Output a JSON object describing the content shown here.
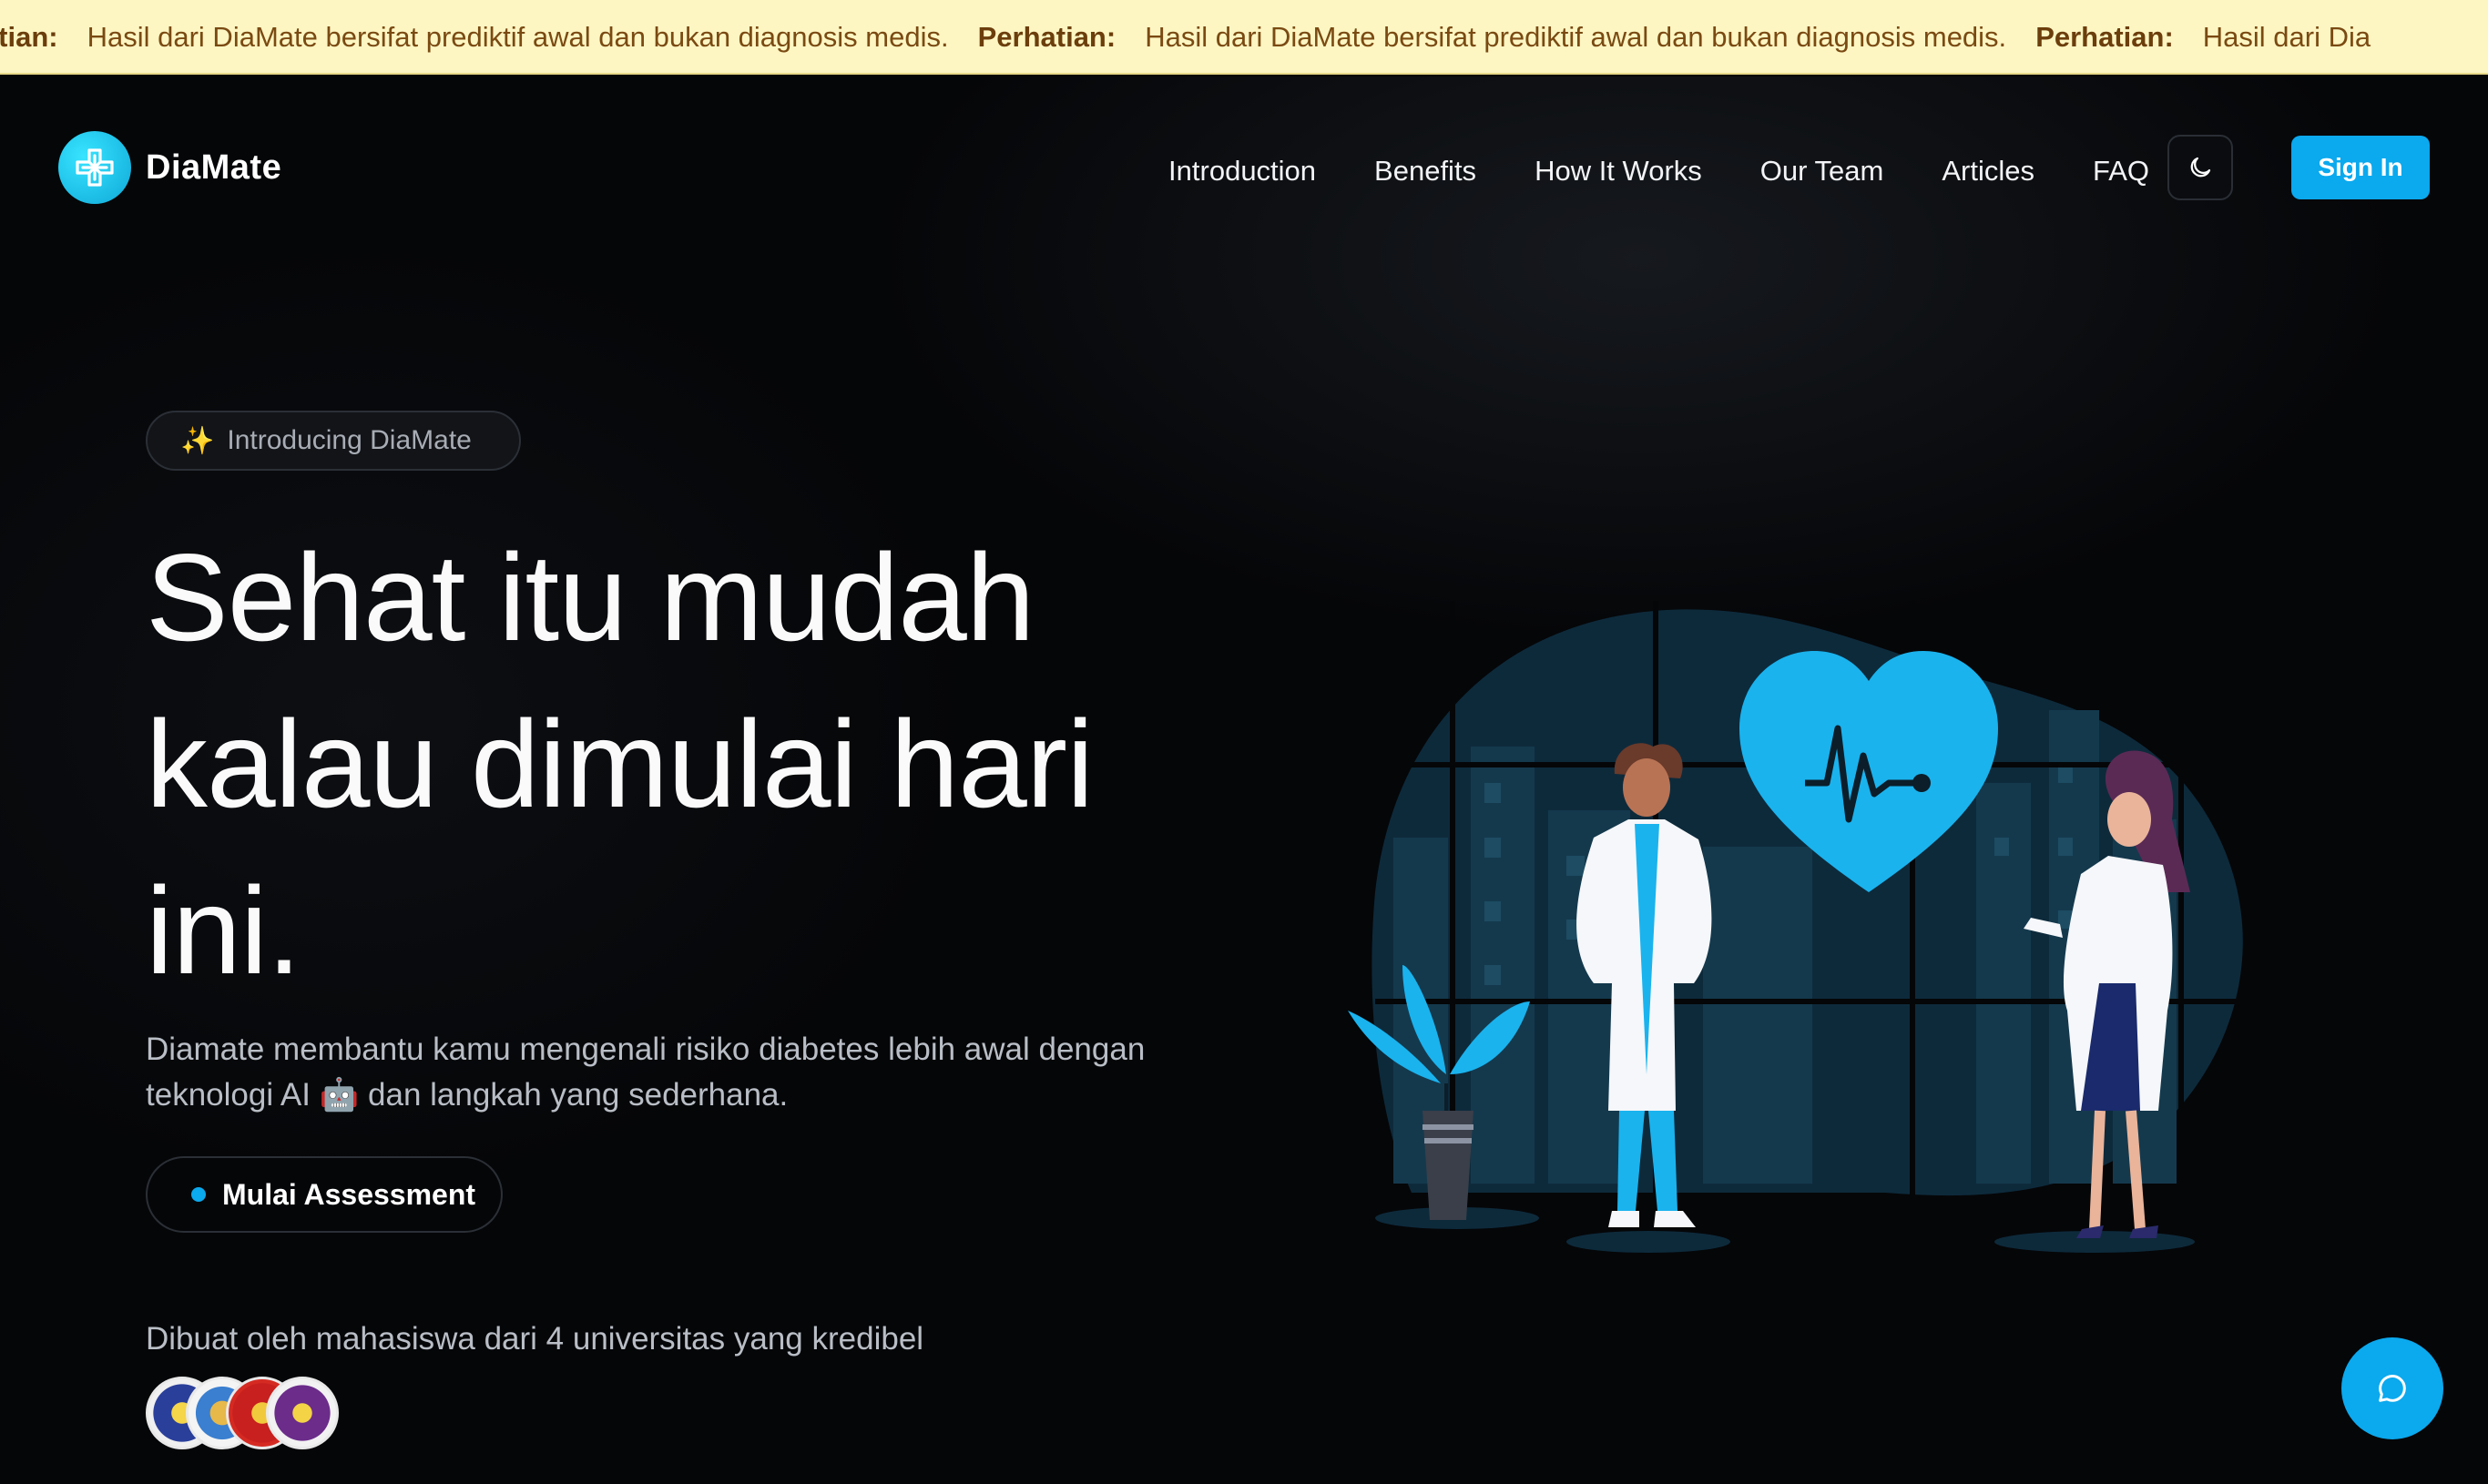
{
  "banner": {
    "label": "Perhatian:",
    "label_cut": "atian:",
    "message": "Hasil dari DiaMate bersifat prediktif awal dan bukan diagnosis medis.",
    "tail": "Hasil dari Dia"
  },
  "brand": {
    "name": "DiaMate",
    "accent": "#0ba9ee",
    "logo_icon": "cross-medical-icon"
  },
  "nav": {
    "links": [
      "Introduction",
      "Benefits",
      "How It Works",
      "Our Team",
      "Articles",
      "FAQ"
    ],
    "theme_icon": "moon-icon",
    "signin_label": "Sign In"
  },
  "hero": {
    "pill_icon": "sparkles-icon",
    "pill_label": "Introducing DiaMate",
    "headline_line1": "Sehat itu mudah",
    "headline_line2": "kalau dimulai hari",
    "headline_line3": "ini.",
    "sub_part1": "Diamate membantu kamu mengenali risiko diabetes lebih awal dengan",
    "sub_part2": "teknologi AI",
    "sub_emoji": "🤖",
    "sub_part3": "dan langkah yang sederhana.",
    "cta_label": "Mulai Assessment",
    "made_by": "Dibuat oleh mahasiswa dari 4 universitas yang kredibel"
  },
  "chat": {
    "icon": "chat-bubble-icon"
  }
}
